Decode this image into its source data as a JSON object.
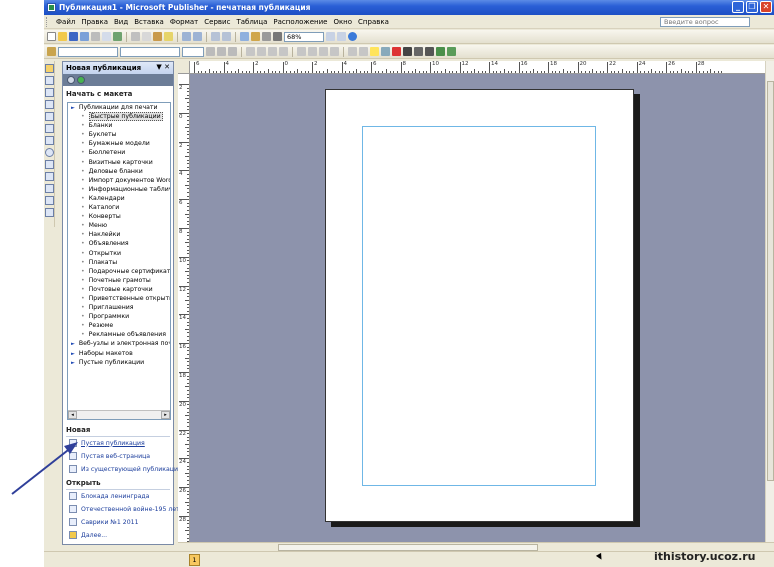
{
  "window": {
    "title": "Публикация1 - Microsoft Publisher - печатная публикация"
  },
  "menu": {
    "items": [
      "Файл",
      "Правка",
      "Вид",
      "Вставка",
      "Формат",
      "Сервис",
      "Таблица",
      "Расположение",
      "Окно",
      "Справка"
    ],
    "help_placeholder": "Введите вопрос"
  },
  "toolbar": {
    "zoom": "68%"
  },
  "taskpane": {
    "title": "Новая публикация",
    "controls": "▼ ✕",
    "start_section": "Начать с макета",
    "tree": [
      {
        "label": "Публикации для печати",
        "level": 0
      },
      {
        "label": "Быстрые публикации",
        "level": 1,
        "selected": true
      },
      {
        "label": "Бланки",
        "level": 1
      },
      {
        "label": "Буклеты",
        "level": 1
      },
      {
        "label": "Бумажные модели",
        "level": 1
      },
      {
        "label": "Бюллетени",
        "level": 1
      },
      {
        "label": "Визитные карточки",
        "level": 1
      },
      {
        "label": "Деловые бланки",
        "level": 1
      },
      {
        "label": "Импорт документов Word",
        "level": 1
      },
      {
        "label": "Информационные таблички",
        "level": 1
      },
      {
        "label": "Календари",
        "level": 1
      },
      {
        "label": "Каталоги",
        "level": 1
      },
      {
        "label": "Конверты",
        "level": 1
      },
      {
        "label": "Меню",
        "level": 1
      },
      {
        "label": "Наклейки",
        "level": 1
      },
      {
        "label": "Объявления",
        "level": 1
      },
      {
        "label": "Открытки",
        "level": 1
      },
      {
        "label": "Плакаты",
        "level": 1
      },
      {
        "label": "Подарочные сертификаты",
        "level": 1
      },
      {
        "label": "Почетные грамоты",
        "level": 1
      },
      {
        "label": "Почтовые карточки",
        "level": 1
      },
      {
        "label": "Приветственные открытки",
        "level": 1
      },
      {
        "label": "Приглашения",
        "level": 1
      },
      {
        "label": "Программки",
        "level": 1
      },
      {
        "label": "Резюме",
        "level": 1
      },
      {
        "label": "Рекламные объявления",
        "level": 1
      },
      {
        "label": "Веб-узлы и электронная почта",
        "level": 0
      },
      {
        "label": "Наборы макетов",
        "level": 0
      },
      {
        "label": "Пустые публикации",
        "level": 0
      }
    ],
    "new_section": "Новая",
    "new_items": [
      "Пустая публикация",
      "Пустая веб-страница",
      "Из существующей публикации..."
    ],
    "open_section": "Открыть",
    "open_items": [
      "Блокада ленинграда",
      "Отечественной войне-195 лет",
      "Саврики №1 2011",
      "Далее..."
    ]
  },
  "rulers": {
    "horizontal": [
      "6",
      "4",
      "2",
      "0",
      "2",
      "4",
      "6",
      "8",
      "10",
      "12",
      "14",
      "16",
      "18",
      "20",
      "22",
      "24",
      "26",
      "28"
    ],
    "vertical": [
      "2",
      "0",
      "2",
      "4",
      "6",
      "8",
      "10",
      "12",
      "14",
      "16",
      "18",
      "20",
      "22",
      "24",
      "26",
      "28",
      "30"
    ]
  },
  "status": {
    "page_number": "1"
  },
  "watermark": "ithistory.ucoz.ru",
  "colors": {
    "workspace": "#8d93ac",
    "titlebar": "#2a5fd6",
    "margin_guide": "#6fb7e6",
    "link": "#1b3d9c"
  }
}
